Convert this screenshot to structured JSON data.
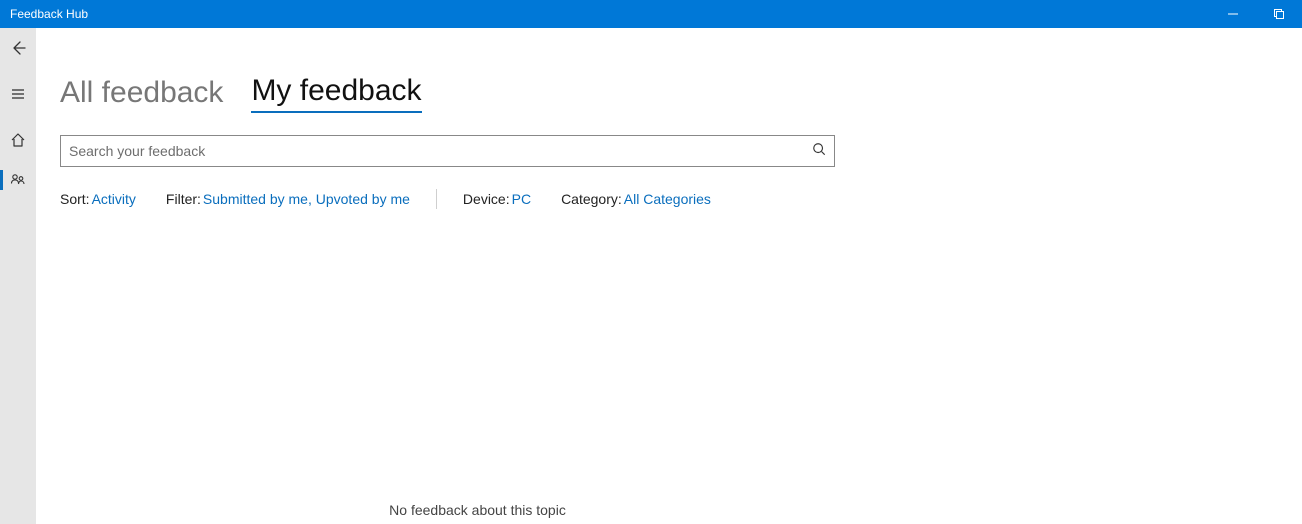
{
  "titlebar": {
    "title": "Feedback Hub"
  },
  "tabs": {
    "all": "All feedback",
    "my": "My feedback"
  },
  "search": {
    "placeholder": "Search your feedback",
    "value": ""
  },
  "filters": {
    "sort_label": "Sort:",
    "sort_value": "Activity",
    "filter_label": "Filter:",
    "filter_value": "Submitted by me, Upvoted by me",
    "device_label": "Device:",
    "device_value": "PC",
    "category_label": "Category:",
    "category_value": "All Categories"
  },
  "empty_state": "No feedback about this topic"
}
